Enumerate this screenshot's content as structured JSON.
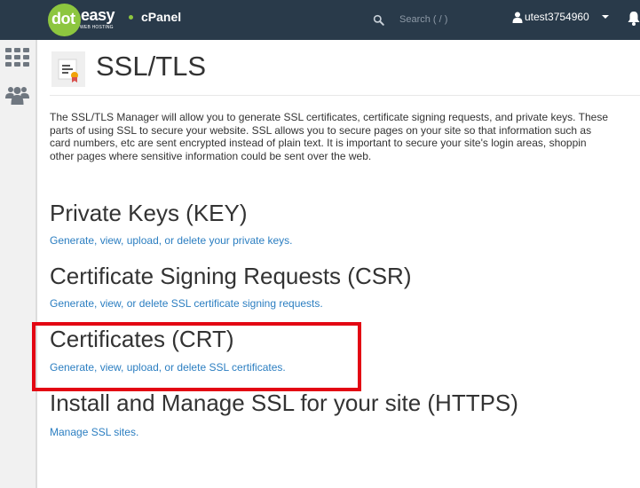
{
  "header": {
    "logo_dot": "dot",
    "logo_easy": "easy",
    "logo_sub": "WEB HOSTING",
    "product": "cPanel",
    "search_placeholder": "Search ( / )",
    "username": "utest3754960"
  },
  "sidebar": {
    "items": [
      {
        "icon": "apps-grid-icon"
      },
      {
        "icon": "users-icon"
      }
    ]
  },
  "page": {
    "title": "SSL/TLS",
    "description_lines": [
      "The SSL/TLS Manager will allow you to generate SSL certificates, certificate signing requests, and private keys. These",
      "parts of using SSL to secure your website. SSL allows you to secure pages on your site so that information such as",
      "card numbers, etc are sent encrypted instead of plain text. It is important to secure your site's login areas, shoppin",
      "other pages where sensitive information could be sent over the web."
    ]
  },
  "sections": [
    {
      "title": "Private Keys (KEY)",
      "link": "Generate, view, upload, or delete your private keys."
    },
    {
      "title": "Certificate Signing Requests (CSR)",
      "link": "Generate, view, or delete SSL certificate signing requests."
    },
    {
      "title": "Certificates (CRT)",
      "link": "Generate, view, upload, or delete SSL certificates."
    },
    {
      "title": "Install and Manage SSL for your site (HTTPS)",
      "link": "Manage SSL sites."
    }
  ],
  "colors": {
    "topbar": "#293a4a",
    "brand_green": "#8dc63f",
    "link": "#2b7ec1",
    "highlight": "#e30613"
  }
}
